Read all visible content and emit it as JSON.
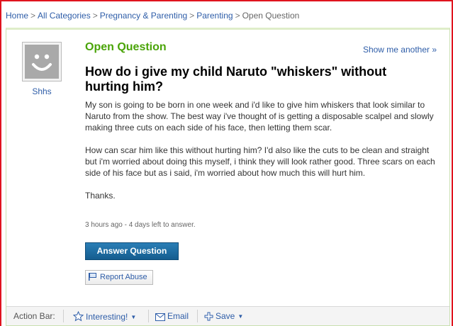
{
  "breadcrumb": {
    "items": [
      "Home",
      "All Categories",
      "Pregnancy & Parenting",
      "Parenting"
    ],
    "current": "Open Question",
    "separator": ">"
  },
  "user": {
    "name": "Shhs"
  },
  "question": {
    "status": "Open Question",
    "show_another": "Show me another »",
    "title": "How do i give my child Naruto \"whiskers\" without hurting him?",
    "paragraphs": [
      "My son is going to be born in one week and i'd like to give him whiskers that look similar to Naruto from the show. The best way i've thought of is getting a disposable scalpel and slowly making three cuts on each side of his face, then letting them scar.",
      "How can scar him like this without hurting him? I'd also like the cuts to be clean and straight but i'm worried about doing this myself, i think they will look rather good. Three scars on each side of his face but as i said, i'm worried about how much this will hurt him.",
      "Thanks."
    ],
    "meta": "3 hours ago - 4 days left to answer."
  },
  "buttons": {
    "answer": "Answer Question",
    "report": "Report Abuse"
  },
  "action_bar": {
    "label": "Action Bar:",
    "interesting": "Interesting!",
    "email": "Email",
    "save": "Save"
  }
}
